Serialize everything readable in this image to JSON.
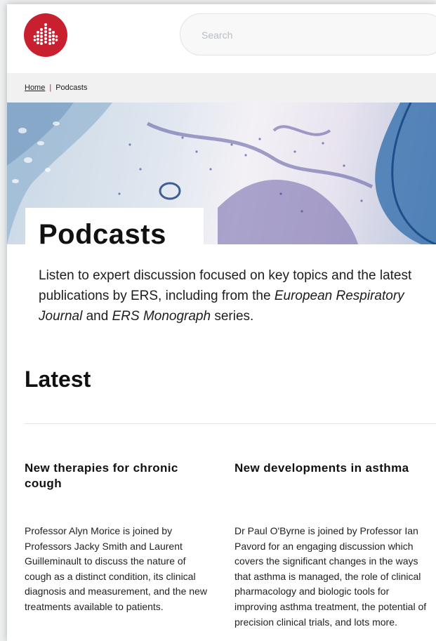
{
  "header": {
    "logo_alt": "ERS logo",
    "search_placeholder": "Search"
  },
  "breadcrumb": {
    "home": "Home",
    "separator": "|",
    "current": "Podcasts"
  },
  "hero": {
    "title": "Podcasts",
    "intro_part1": "Listen to expert discussion focused on key topics and the latest publications by ERS, including from the ",
    "intro_journal": "European Respiratory Journal",
    "intro_part2": " and ",
    "intro_monograph": "ERS Monograph",
    "intro_part3": " series."
  },
  "latest": {
    "heading": "Latest",
    "cards": [
      {
        "title": "New therapies for chronic cough",
        "description": "Professor Alyn Morice is joined by Professors Jacky Smith and Laurent Guilleminault to discuss the nature of cough as a distinct condition, its clinical diagnosis and measurement, and the new treatments available to patients."
      },
      {
        "title": "New developments in asthma",
        "description": "Dr Paul O'Byrne is joined by Professor Ian Pavord for an engaging discussion which covers the significant changes in the ways that asthma is managed, the role of clinical pharmacology and biologic tools for improving asthma treatment, the potential of precision clinical trials, and lots more."
      }
    ]
  },
  "colors": {
    "brand_red": "#c8202f",
    "breadcrumb_bg": "#f1f1f1",
    "divider": "#e2e2e2"
  }
}
